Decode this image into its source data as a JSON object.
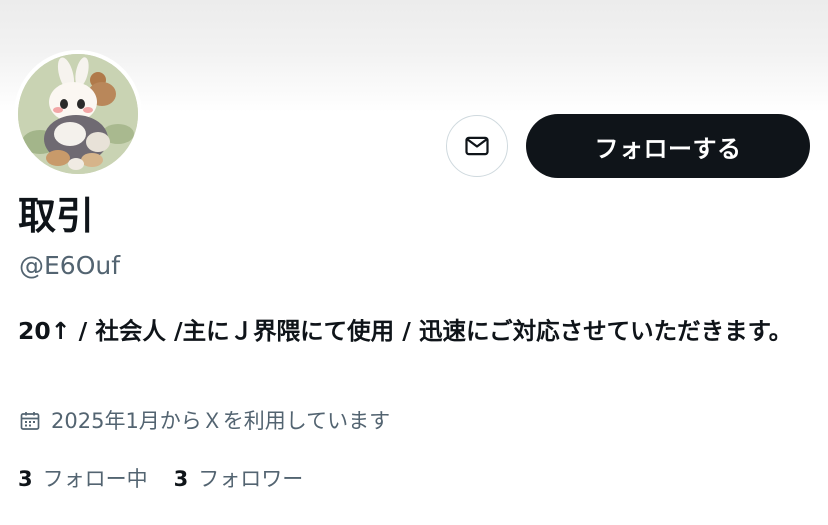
{
  "profile": {
    "display_name": "取引",
    "handle": "@E6Ouf",
    "bio": "20↑ / 社会人 /主にＪ界隈にて使用 / 迅速にご対応させていただきます。",
    "joined_text": "2025年1月からＸを利用しています",
    "following_count": "3",
    "following_label": "フォロー中",
    "followers_count": "3",
    "followers_label": "フォロワー"
  },
  "actions": {
    "follow_label": "フォローする"
  },
  "icons": {
    "mail": "envelope-icon",
    "calendar": "calendar-icon"
  },
  "colors": {
    "primary_text": "#0f1419",
    "secondary_text": "#536471",
    "button_dark": "#0f1419",
    "border": "#cfd9de"
  }
}
